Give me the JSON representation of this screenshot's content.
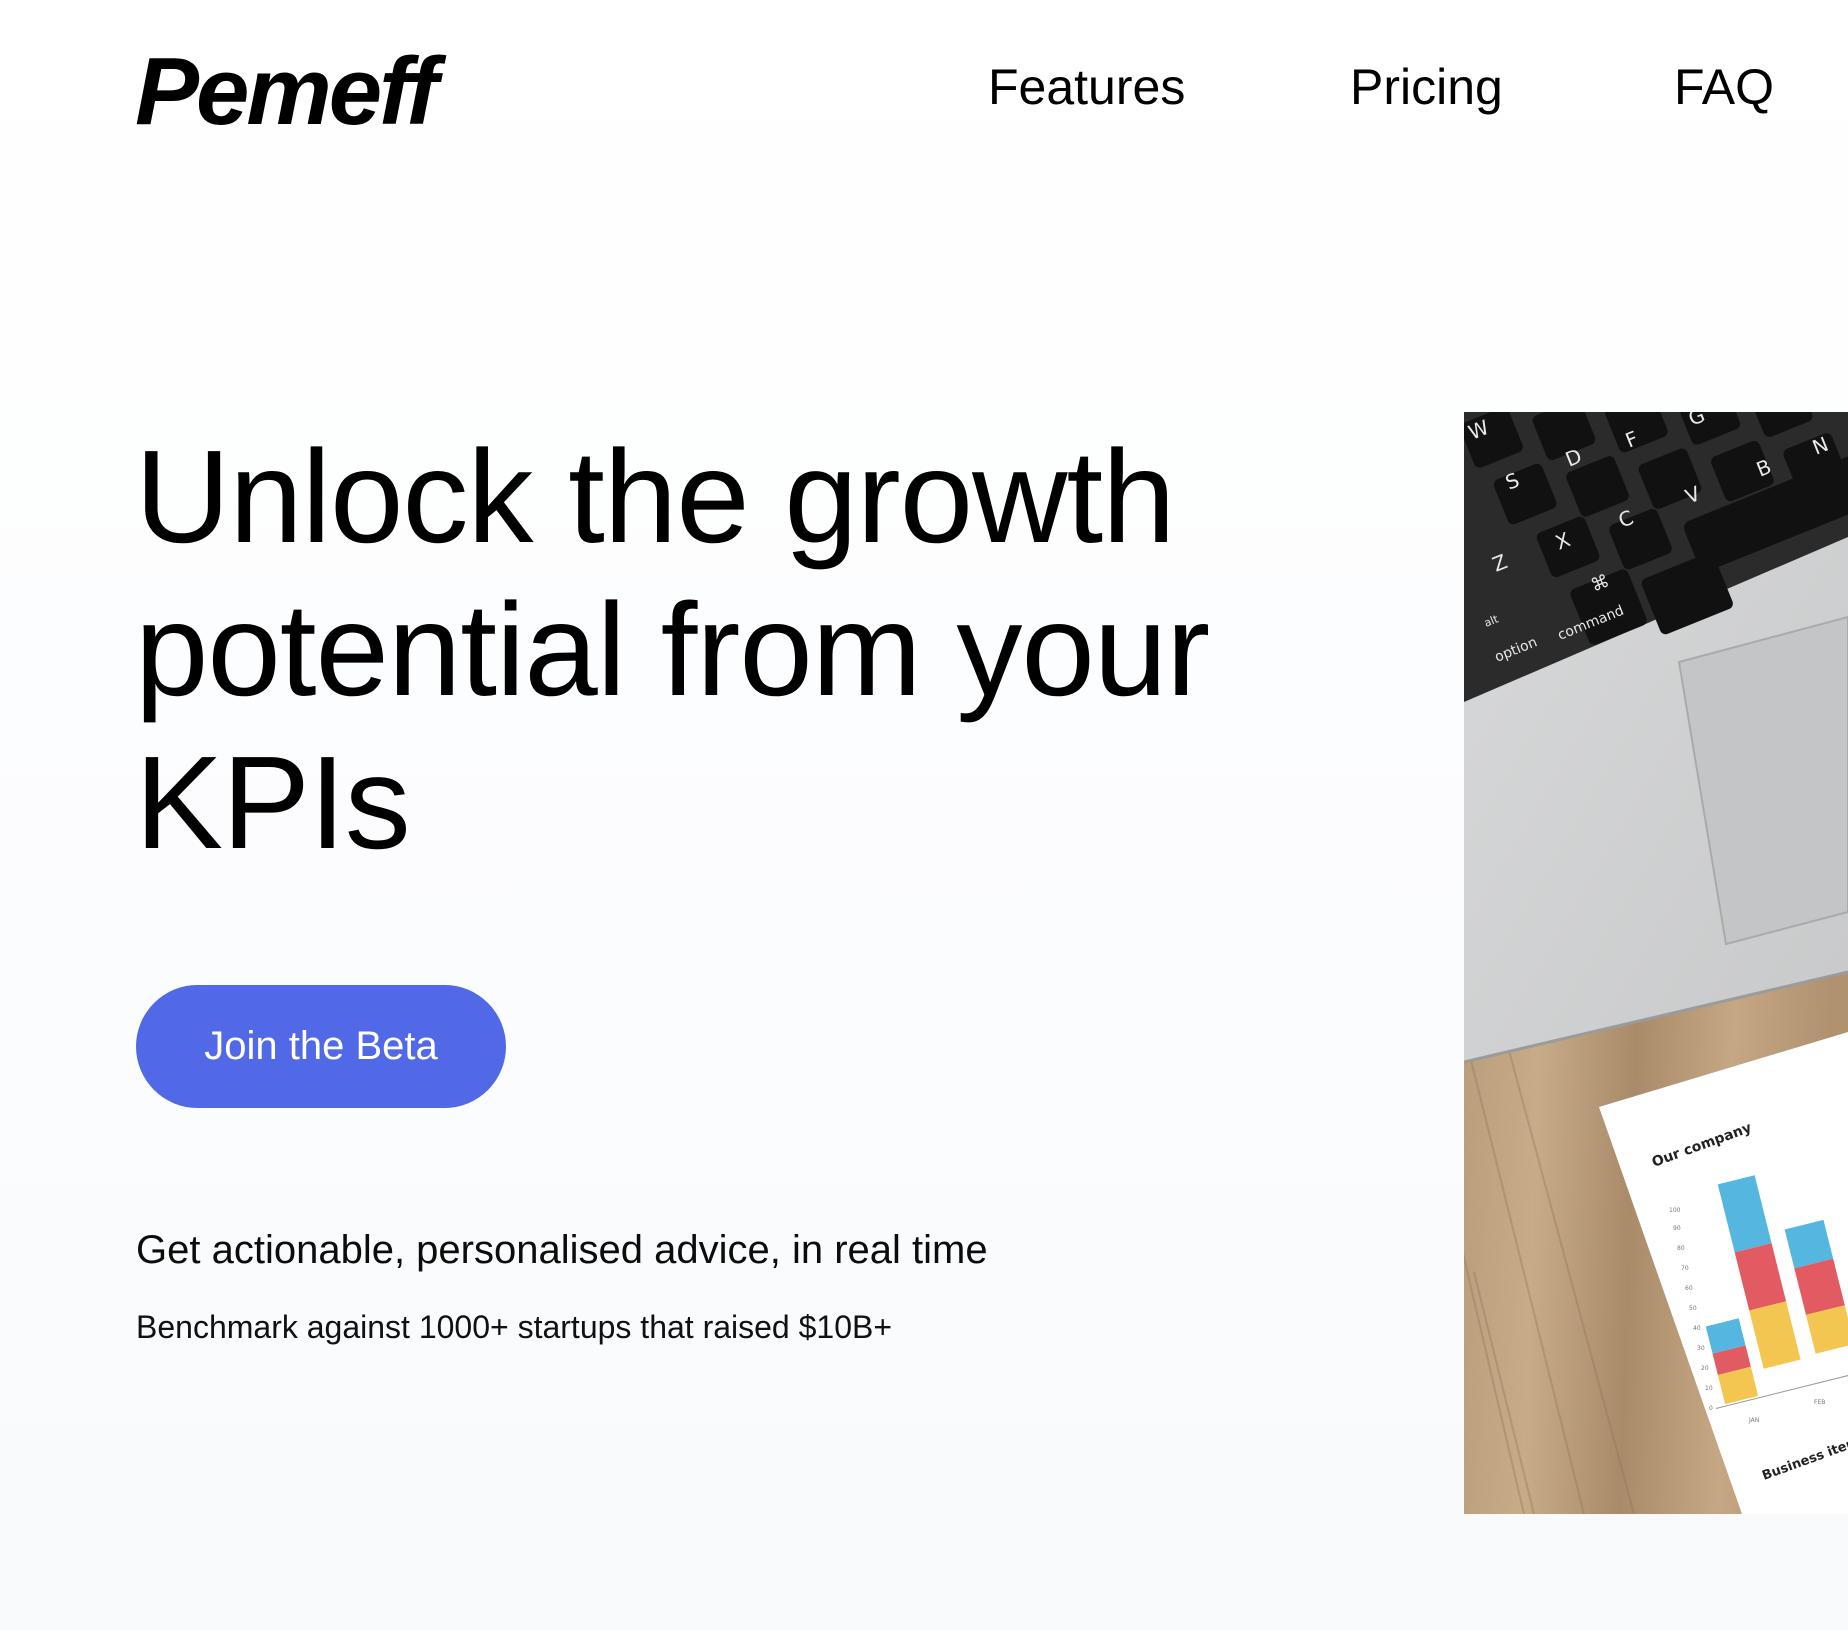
{
  "brand": {
    "logo": "Pemeff"
  },
  "nav": {
    "features": "Features",
    "pricing": "Pricing",
    "faq": "FAQ"
  },
  "hero": {
    "headline": "Unlock the growth potential from your KPIs",
    "cta_label": "Join the Beta",
    "subhead": "Get actionable, personalised advice, in real time",
    "benchmark": "Benchmark against 1000+ startups that raised $10B+"
  },
  "image": {
    "keys": [
      "W",
      "S",
      "D",
      "F",
      "G",
      "B",
      "N",
      "Z",
      "X",
      "C",
      "V",
      "⌘",
      "alt",
      "option",
      "command"
    ],
    "report_title": "Our company",
    "report_footer": "Business item",
    "axis_ticks": [
      "100",
      "90",
      "80",
      "70",
      "60",
      "50",
      "40",
      "30",
      "20",
      "10",
      "0"
    ],
    "month_labels": [
      "JAN",
      "FEB"
    ]
  },
  "colors": {
    "accent": "#5169e6",
    "text": "#000000",
    "background": "#fbfcfe",
    "chart_blue": "#55b6df",
    "chart_red": "#e25b63",
    "chart_yellow": "#f2c650"
  }
}
